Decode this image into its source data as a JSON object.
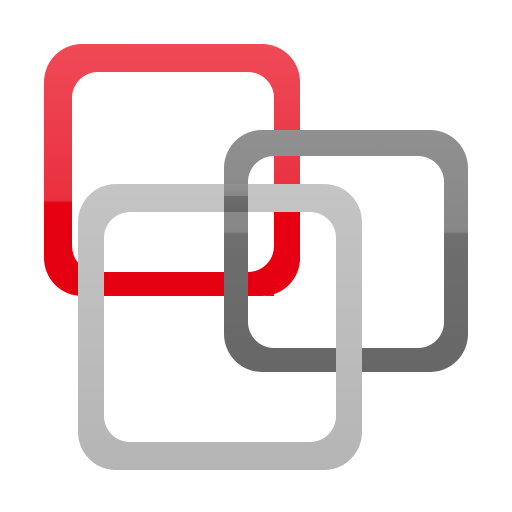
{
  "logo": {
    "name": "overlapping-rounded-squares-logo",
    "colors": {
      "red_top": "#EE4450",
      "red_bottom": "#E60012",
      "light_gray": "#BDBDBD",
      "dark_gray_top": "#8C8C8C",
      "dark_gray_bottom": "#6A6A6A",
      "background": "#FFFFFF"
    }
  }
}
